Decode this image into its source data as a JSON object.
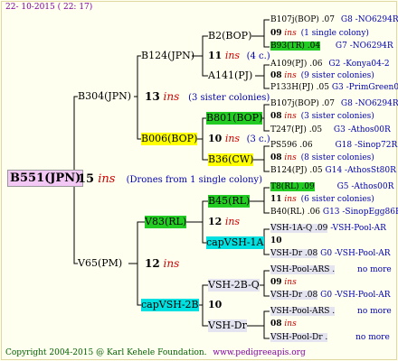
{
  "header": {
    "date": "22- 10-2015 ( 22: 17)"
  },
  "footer": {
    "copyright": "Copyright 2004-2015 @ Karl Kehele Foundation.",
    "site": "www.pedigreeapis.org"
  },
  "root": {
    "name": "B551(JPN)",
    "year": "15",
    "ins": "ins",
    "note": "(Drones from 1 single colony)"
  },
  "gen1": [
    {
      "name": "B304(JPN)",
      "year": "13",
      "ins": "ins",
      "note": "(3 sister colonies)"
    },
    {
      "name": "V65(PM)",
      "year": "12",
      "ins": "ins"
    }
  ],
  "gen2": [
    {
      "name": "B124(JPN)",
      "year": "11",
      "ins": "ins",
      "note": "(4 c.)"
    },
    {
      "name": "B006(BOP)",
      "year": "10",
      "ins": "ins",
      "note": "(3 c.)"
    },
    {
      "name": "V83(RL)",
      "year": "12",
      "ins": "ins"
    },
    {
      "name": "capVSH-2B",
      "year": "10"
    }
  ],
  "gen3": [
    {
      "name": "B2(BOP)"
    },
    {
      "name": "A141(PJ)"
    },
    {
      "name": "B801(BOP)"
    },
    {
      "name": "B36(CW)"
    },
    {
      "name": "B45(RL)"
    },
    {
      "name": "capVSH-1A"
    },
    {
      "name": "VSH-2B-Q"
    },
    {
      "name": "VSH-Dr"
    }
  ],
  "gen4": [
    {
      "name": "B107j(BOP) .07",
      "code": "G8 -NO6294R"
    },
    {
      "year": "09",
      "ins": "ins",
      "note": "(1 single colony)"
    },
    {
      "name": "B93(TR) .04",
      "code": "G7 -NO6294R"
    },
    {
      "name": "A109(PJ) .06",
      "code": "G2 -Konya04-2"
    },
    {
      "year": "08",
      "ins": "ins",
      "note": "(9 sister colonies)"
    },
    {
      "name": "P133H(PJ) .05",
      "code": "G3 -PrimGreen00"
    },
    {
      "name": "B107j(BOP) .07",
      "code": "G8 -NO6294R"
    },
    {
      "year": "08",
      "ins": "ins",
      "note": "(3 sister colonies)"
    },
    {
      "name": "T247(PJ) .05",
      "code": "G3 -Athos00R"
    },
    {
      "name": "PS596 .06",
      "code": "G18 -Sinop72R"
    },
    {
      "year": "08",
      "ins": "ins",
      "note": "(8 sister colonies)"
    },
    {
      "name": "B124(PJ) .05",
      "code": "G14 -AthosSt80R"
    },
    {
      "name": "T8(RL) .09",
      "code": "G5 -Athos00R"
    },
    {
      "year": "11",
      "ins": "ins",
      "note": "(6 sister colonies)"
    },
    {
      "name": "B40(RL) .06",
      "code": "G13 -SinopEgg86R"
    },
    {
      "name": "VSH-1A-Q .09",
      "code": "-VSH-Pool-AR"
    },
    {
      "year": "10"
    },
    {
      "name": "VSH-Dr .08",
      "code": "G0 -VSH-Pool-AR"
    },
    {
      "name": "VSH-Pool-ARS .",
      "code": "no more"
    },
    {
      "year": "09",
      "ins": "ins"
    },
    {
      "name": "VSH-Dr .08",
      "code": "G0 -VSH-Pool-AR"
    },
    {
      "name": "VSH-Pool-ARS .",
      "code": "no more"
    },
    {
      "year": "08",
      "ins": "ins"
    },
    {
      "name": "VSH-Pool-Dr .",
      "code": "no more"
    }
  ],
  "colors": {
    "background": "#fffff0",
    "ins": "#d00000",
    "green_highlight": "#22cc22",
    "yellow_highlight": "#ffff00",
    "cyan_highlight": "#00e0e0",
    "root_highlight": "#f4c8f4"
  }
}
